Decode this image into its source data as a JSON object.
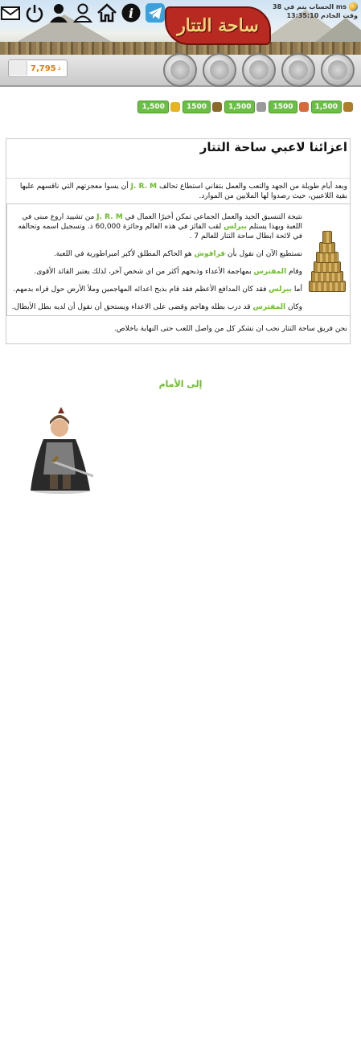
{
  "header": {
    "logo_text": "ساحة التتار",
    "account_line1": "الحساب يتم في 38 ms",
    "account_line2": "وقت الخادم 13:35:10",
    "icons": [
      "telegram-icon",
      "info-icon",
      "home-icon",
      "profile-icon",
      "player-icon",
      "power-icon",
      "messages-icon"
    ]
  },
  "navbar": {
    "gold_value": "7,795",
    "gold_currency": "ذ",
    "buttons": [
      "village-overview",
      "village-center",
      "map",
      "statistics",
      "reports"
    ]
  },
  "resources": [
    {
      "value": "1,500",
      "color": "#b07d2b"
    },
    {
      "value": "1500",
      "color": "#d66a3a"
    },
    {
      "value": "1,500",
      "color": "#9a9a9a"
    },
    {
      "value": "1500",
      "color": "#8a6a2a"
    },
    {
      "value": "1,500",
      "color": "#e6b323"
    }
  ],
  "message": {
    "title": "اعزائنا لاعبي ساحة التتار",
    "intro_before": "وبعد أيام طويلة من الجهد والتعب والعمل بتفاني استطاع تحالف",
    "intro_alliance": "J. R. M",
    "intro_after": "أن يسوا معجزتهم التي ناقسهم عليها بقية اللاعبين، حيث رصدوا لها الملايين من الموارد.",
    "p1_before": "نتيجة التنسيق الجيد والعمل الجماعي تمكن أخيرًا العمال في",
    "p1_alliance": "J. R. M",
    "p1_middle": "من تشييد اروع مبنى في اللعبة وبهذا يستلم",
    "p1_player": "بيرلس",
    "p1_after": "لقب الفائز في هذه العالم وجائزة 60,000 ذ. وتسجيل اسمه وتحالفه في لائحة ابطال ساحة التتار للعالم 7 .",
    "p2_before": "نستطيع الآن ان نقول بأن",
    "p2_player": "قراقوش",
    "p2_after": "هو الحاكم المطلق لأكبر امبراطورية في اللعبة.",
    "p3_before": "وقام",
    "p3_player": "المفترس",
    "p3_after": "بمهاجمة الأعداء وذبحهم أكثر من اي شخص آخر، لذلك يعتبر القائد الأقوى.",
    "p4_before": "أما",
    "p4_player": "بيرلس",
    "p4_after": "فقد كان المدافع الأعظم فقد قام بذبح اعدائه المهاجمين وملأ الأرض حول قراه بدمهم.",
    "p5_before": "وكان",
    "p5_player": "المفترس",
    "p5_after": "قد درب بطله وهاجم وقضى على الاعداء ويستحق أن نقول أن لديه بطل الأبطال.",
    "footer": "نحن فريق ساحة التتار نحب ان نشكر كل من واصل اللعب حتى النهاية باخلاص."
  },
  "forward_link": "إلى الأمام"
}
